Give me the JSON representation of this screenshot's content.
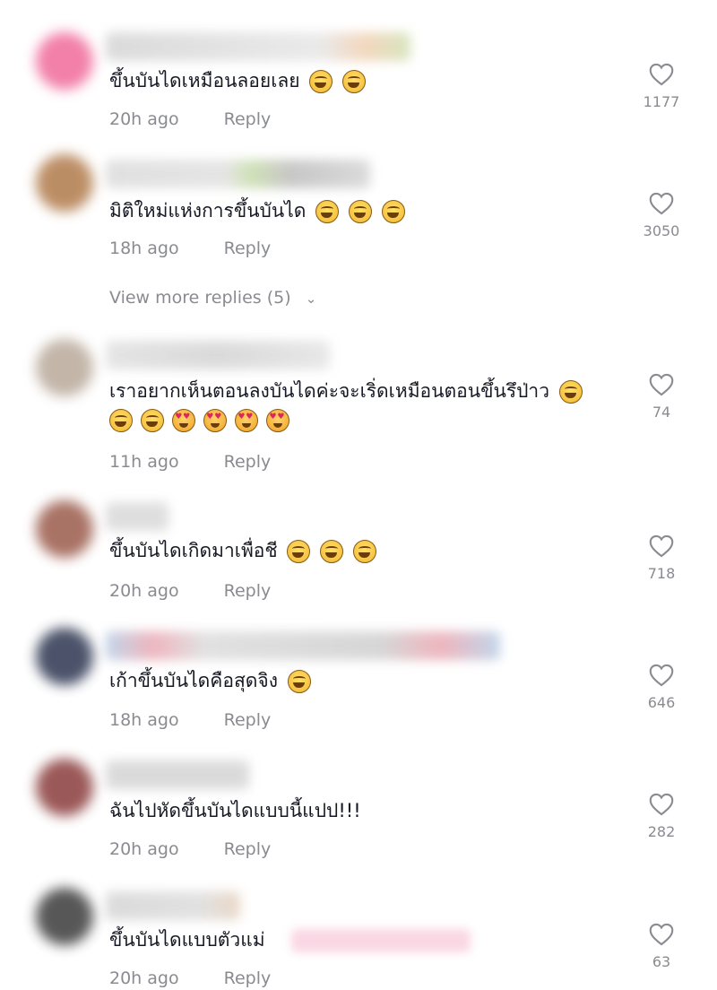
{
  "comments": [
    {
      "text": "ขึ้นบันไดเหมือนลอยเลย",
      "emojis": [
        "laugh",
        "laugh"
      ],
      "time": "20h ago",
      "reply": "Reply",
      "likes": "1177"
    },
    {
      "text": "มิติใหม่แห่งการขึ้นบันได",
      "emojis": [
        "laugh",
        "laugh",
        "laugh"
      ],
      "time": "18h ago",
      "reply": "Reply",
      "likes": "3050"
    },
    {
      "text": "เราอยากเห็นตอนลงบันไดค่ะจะเริ่ดเหมือนตอนขึ้นรึป่าว",
      "emojis": [
        "laugh"
      ],
      "emojis_line2": [
        "laugh",
        "laugh",
        "heart-eyes",
        "heart-eyes",
        "heart-eyes",
        "heart-eyes"
      ],
      "time": "11h ago",
      "reply": "Reply",
      "likes": "74"
    },
    {
      "text": "ขึ้นบันไดเกิดมาเพื่อชี",
      "emojis": [
        "laugh",
        "laugh",
        "laugh"
      ],
      "time": "20h ago",
      "reply": "Reply",
      "likes": "718"
    },
    {
      "text": "เก้าขึ้นบันไดคือสุดจิง",
      "emojis": [
        "laugh"
      ],
      "time": "18h ago",
      "reply": "Reply",
      "likes": "646"
    },
    {
      "text": "ฉันไปหัดขึ้นบันไดแบบนี้แปป!!!",
      "emojis": [],
      "time": "20h ago",
      "reply": "Reply",
      "likes": "282"
    },
    {
      "text": "ขึ้นบันไดแบบตัวแม่",
      "emojis": [],
      "time": "20h ago",
      "reply": "Reply",
      "likes": "63"
    }
  ],
  "view_more": {
    "label": "View more replies (5)",
    "icon": "chevron-down-icon"
  },
  "colors": {
    "text": "#161823",
    "muted": "#8a8b91",
    "background": "#ffffff"
  }
}
